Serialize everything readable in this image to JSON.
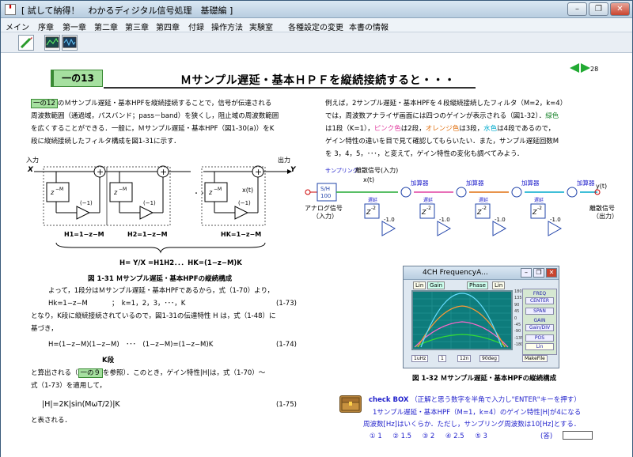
{
  "window": {
    "title": "[ 試して納得！　わかるディジタル信号処理　基礎編 ]",
    "app_icon_label": "Hand book",
    "buttons": {
      "minimize": "–",
      "restore": "❐",
      "close": "✕"
    }
  },
  "menu": [
    "メイン",
    "序章",
    "第一章",
    "第二章",
    "第三章",
    "第四章",
    "付録",
    "操作方法",
    "実験室",
    "各種設定の変更",
    "本書の情報"
  ],
  "toolbar": [
    "pen-tool",
    "scope-tool",
    "scope2-tool"
  ],
  "page": {
    "section_tag": "一の13",
    "heading": "Ｍサンプル遅延・基本ＨＰＦを縦続接続すると・・・",
    "page_number": "28",
    "nav_prev": "◀",
    "nav_next": "▶"
  },
  "left": {
    "p1_tag": "一の12",
    "p1_l1": "のＭサンプル遅延・基本HPFを縦続接続することで，信号が伝達される",
    "p1_l2": "周波数範囲（通過域，パスバンド；pass－band）を狭くし，阻止域の周波数範囲",
    "p1_l3": "を広くすることができる．一般に，Ｍサンプル遅延・基本HPF（図1-30(a)）をK",
    "p1_l4": "段に縦続接続したフィルタ構成を図1-31に示す．",
    "fig1": {
      "in_label": "入力",
      "x_label": "X",
      "out_label": "出力",
      "y_label": "Y",
      "z_label": "z",
      "z_exp": "−M",
      "gain": "(−1)",
      "plus": "+",
      "dots": "・・・・",
      "xt": "x(t)",
      "h1": "H1=1−z−M",
      "h2": "H2=1−z−M",
      "hk": "HK=1−z−M",
      "formula": "H= Y/X =H1H2．．．HK=(1−z−M)K"
    },
    "fig1_caption": "図 1-31  Ｍサンプル遅延・基本HPFの縦続構成",
    "p2_l1": "よって，1段分はＭサンプル遅延・基本HPFであるから，式（1-70）より，",
    "eq73_lhs": "Hk=1−z−M",
    "eq73_rhs": "；　k=1，2，3，･･･，K",
    "eq73_no": "(1-73)",
    "p3_l1": "となり，K段に縦続接続されているので，図1-31の伝達特性 H は，式（1-48）に",
    "p3_l2": "基づき，",
    "eq74": "H=(1−z−M)(1−z−M)　･･･　(1−z−M)=(1−z−M)K",
    "eq74_brace": "K段",
    "eq74_no": "(1-74)",
    "p4_l1a": "と算出される（",
    "p4_tag": "一の９",
    "p4_l1b": "を参照）．このとき，ゲイン特性|H|は，式（1-70）～",
    "p4_l2": "式（1-73）を適用して，",
    "eq75": "|H|=2K|sin(MωT/2)|K",
    "eq75_no": "(1-75)",
    "p5": "と表される．"
  },
  "right": {
    "r1_l1": "例えば，2サンプル遅延・基本HPFを４段縦続接続したフィルタ（M=2，k=4）",
    "r1_l2a": "では，周波数アナライザ画面には四つのゲインが表示される（図1-32）．",
    "r1_l2b": "緑色",
    "r1_l3a": "は1段（K=1），",
    "r1_l3b": "ピンク色",
    "r1_l3c": "は2段，",
    "r1_l3d": "オレンジ色",
    "r1_l3e": "は3段，",
    "r1_l3f": "水色",
    "r1_l3g": "は4段であるので，",
    "r1_l4": "ゲイン特性の違いを目で見て確認してもらいたい．また，サンプル遅延回数M",
    "r1_l5": "を 3，4，5，･･･，と変えて，ゲイン特性の変化も調べてみよう．",
    "fig2": {
      "sampling": "サンプリング",
      "discrete_in": "離散信号(入力)",
      "xt": "x(t)",
      "sh": "S/H",
      "sh_val": "100",
      "analog": "アナログ信号",
      "analog_sub": "（入力）",
      "adder": "加算器",
      "delay": "遅延",
      "z": "Z",
      "z_exp": "-2",
      "gain": "-1.0",
      "yt": "y(t)",
      "discrete_out": "離散信号",
      "discrete_out_sub": "（出力）"
    },
    "freq": {
      "title": "4CH FrequencyA...",
      "lin": "Lin",
      "gain": "Gain",
      "phase": "Phase",
      "lin2": "Lin",
      "y_ticks": [
        "180",
        "135",
        "90",
        "45",
        "0",
        "-45",
        "-90",
        "-135",
        "-180"
      ],
      "bottom": [
        "1uHz",
        "1",
        "12n",
        "90deg"
      ],
      "make_file": "MakeFile",
      "panel": [
        "FREQ",
        "CENTER",
        "SPAN",
        "GAIN",
        "Gain/DIV",
        "POS",
        "Lin"
      ]
    },
    "fig2_caption": "図  1-32  Ｍサンプル遅延・基本HPFの縦続構成",
    "check_title": "check BOX",
    "check_instr": "（正解と思う数字を半角で入力し\"ENTER\"キーを押す）",
    "check_l1": "1サンプル遅延・基本HPF（M=1，k=4）のゲイン特性|H|が4になる",
    "check_l2": "周波数[Hz]はいくらか．ただし，サンプリング周波数は10[Hz]とする．",
    "choices": [
      "① 1",
      "② 1.5",
      "③ 2",
      "④ 2.5",
      "⑤ 3"
    ],
    "answer_label": "(答)"
  },
  "colors": {
    "accent_green": "#22aa33",
    "tag_green": "#a6e0a0",
    "pink": "#e040a0",
    "orange": "#e07010",
    "cyan": "#00aacc",
    "check_blue": "#2222cc"
  }
}
